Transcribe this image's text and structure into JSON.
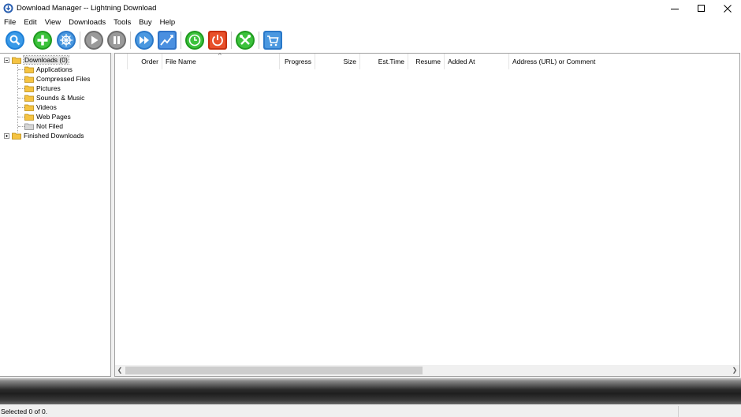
{
  "window": {
    "title": "Download Manager -- Lightning Download"
  },
  "menu": [
    "File",
    "Edit",
    "View",
    "Downloads",
    "Tools",
    "Buy",
    "Help"
  ],
  "toolbar_icons": [
    {
      "name": "search-icon",
      "color": "#1e7fd6"
    },
    {
      "name": "add-icon",
      "color": "#2fb52f"
    },
    {
      "name": "settings-wheel-icon",
      "color": "#3a8fd8"
    },
    {
      "name": "play-icon",
      "color": "#8a8a8a"
    },
    {
      "name": "pause-icon",
      "color": "#8a8a8a"
    },
    {
      "name": "fast-forward-icon",
      "color": "#3a8fd8"
    },
    {
      "name": "speed-graph-icon",
      "color": "#2f73c8"
    },
    {
      "name": "clock-icon",
      "color": "#2fb52f"
    },
    {
      "name": "power-icon",
      "color": "#e04020"
    },
    {
      "name": "tools-icon",
      "color": "#2fb52f"
    },
    {
      "name": "cart-icon",
      "color": "#3a8fd8"
    }
  ],
  "tree": {
    "root": "Downloads (0)",
    "children": [
      "Applications",
      "Compressed Files",
      "Pictures",
      "Sounds & Music",
      "Videos",
      "Web Pages",
      "Not Filed"
    ],
    "finished": "Finished Downloads"
  },
  "columns": [
    "Order",
    "File Name",
    "Progress",
    "Size",
    "Est.Time",
    "Resume",
    "Added At",
    "Address (URL) or Comment"
  ],
  "status": {
    "text": "Selected 0 of 0."
  }
}
